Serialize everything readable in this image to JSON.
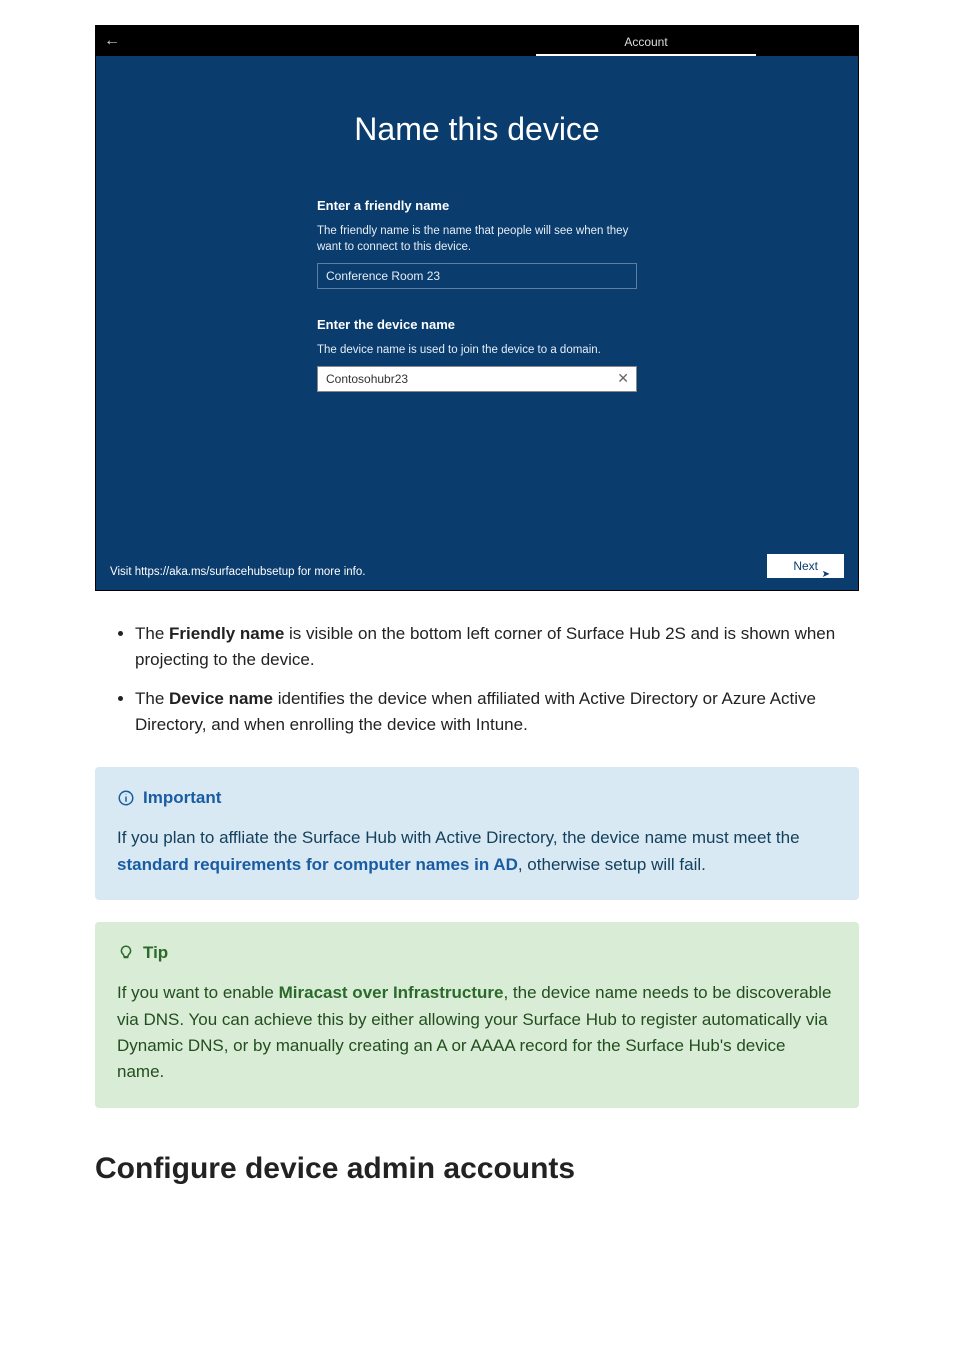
{
  "figure": {
    "topbar": {
      "tab_label": "Account"
    },
    "title": "Name this device",
    "friendly": {
      "label": "Enter a friendly name",
      "desc": "The friendly name is the name that people will see when they want to connect to this device.",
      "value": "Conference Room 23"
    },
    "device": {
      "label": "Enter the device name",
      "desc": "The device name is used to join the device to a domain.",
      "value": "Contosohubr23"
    },
    "footer_link": "Visit https://aka.ms/surfacehubsetup for more info.",
    "next_label": "Next"
  },
  "list": {
    "item1_prefix": "The ",
    "item1_bold": "Friendly name",
    "item1_rest": " is visible on the bottom left corner of Surface Hub 2S and is shown when projecting to the device.",
    "item2_prefix": "The ",
    "item2_bold": "Device name",
    "item2_rest": " identifies the device when affiliated with Active Directory or Azure Active Directory, and when enrolling the device with Intune."
  },
  "important": {
    "title": "Important",
    "p1": "If you plan to affliate the Surface Hub with Active Directory, the device name must meet the ",
    "link": "standard requirements for computer names in AD",
    "p2": ", otherwise setup will fail."
  },
  "tip": {
    "title": "Tip",
    "p1": "If you want to enable ",
    "link": "Miracast over Infrastructure",
    "p2": ", the device name needs to be discoverable via DNS. You can achieve this by either allowing your Surface Hub to register automatically via Dynamic DNS, or by manually creating an A or AAAA record for the Surface Hub's device name."
  },
  "section_heading": "Configure device admin accounts"
}
